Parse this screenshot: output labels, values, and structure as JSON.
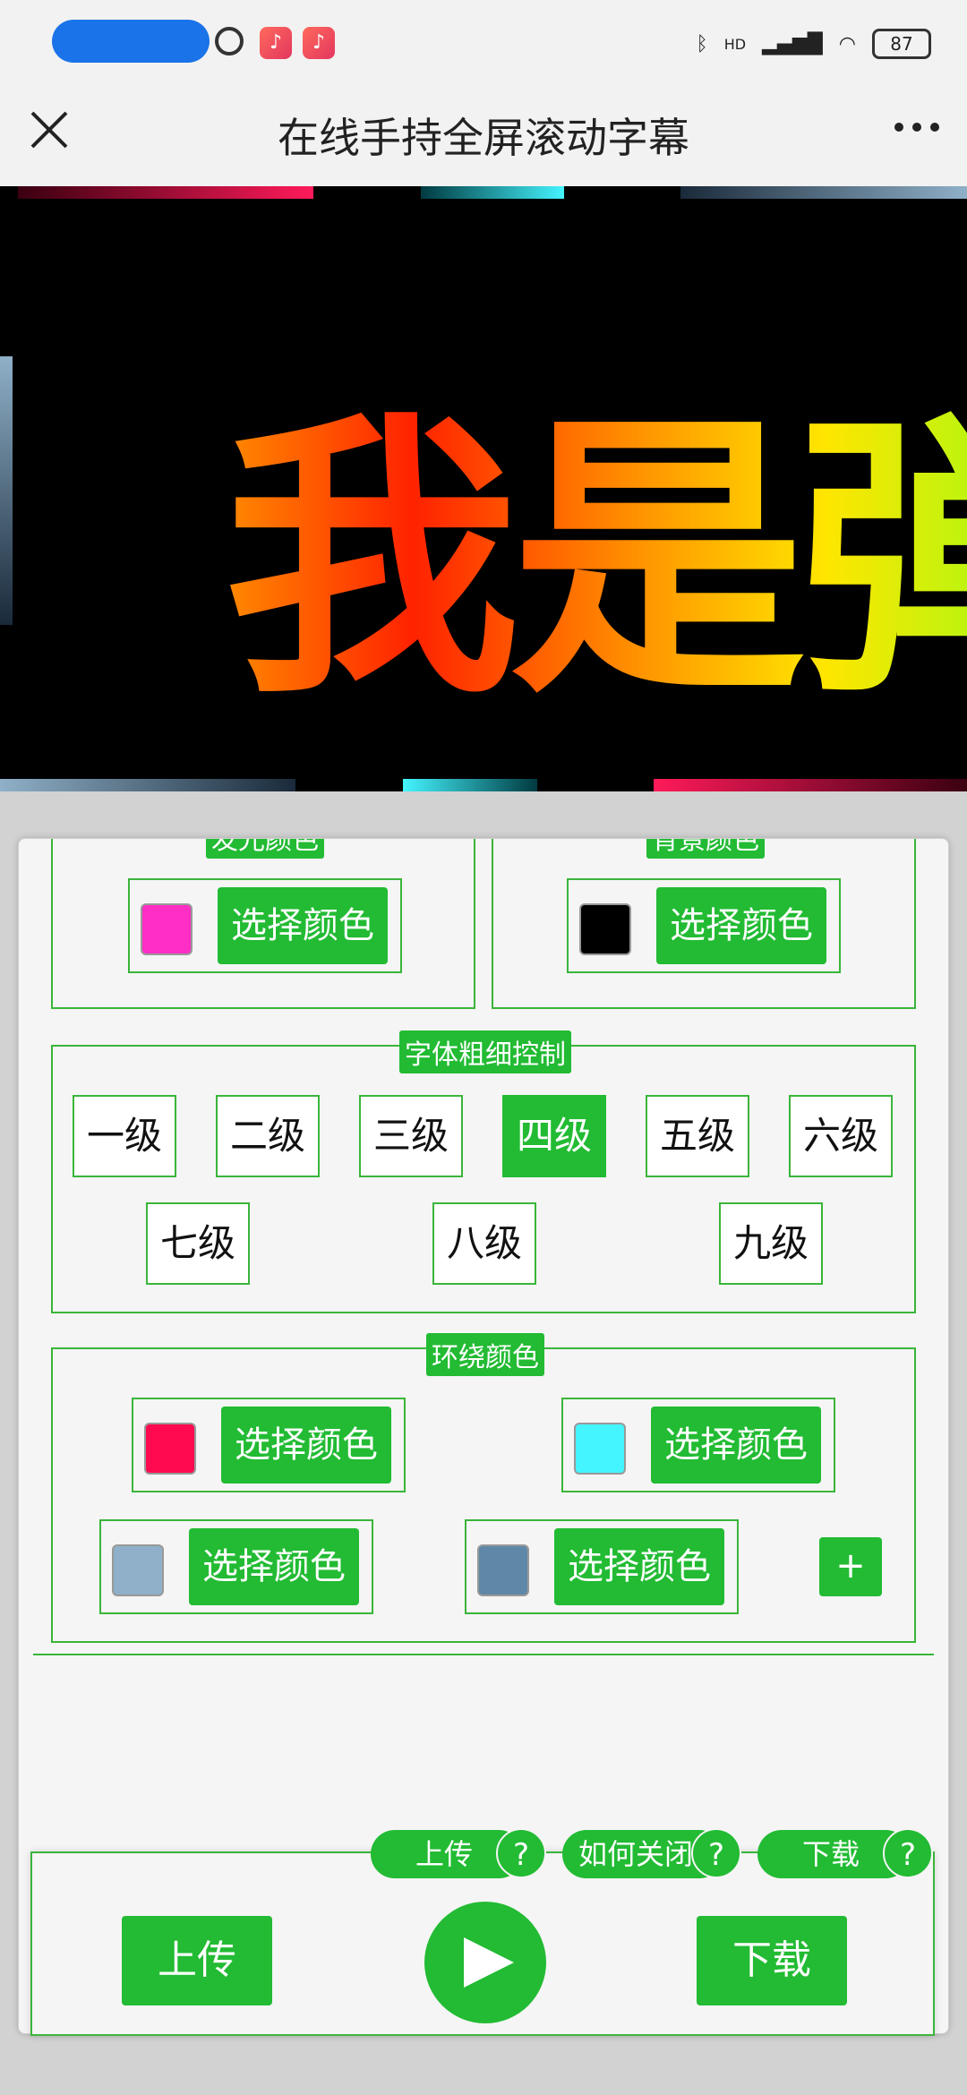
{
  "status_bar": {
    "battery": "87",
    "network_label": "HD"
  },
  "header": {
    "title": "在线手持全屏滚动字幕"
  },
  "preview": {
    "text": "我是弹"
  },
  "glow_color": {
    "legend": "发光颜色",
    "swatch_color": "#ff2ec4",
    "button": "选择颜色"
  },
  "background_color": {
    "legend": "背景颜色",
    "swatch_color": "#000000",
    "button": "选择颜色"
  },
  "font_weight": {
    "legend": "字体粗细控制",
    "levels": [
      "一级",
      "二级",
      "三级",
      "四级",
      "五级",
      "六级",
      "七级",
      "八级",
      "九级"
    ],
    "selected": "四级"
  },
  "surround_color": {
    "legend": "环绕颜色",
    "pickers": [
      {
        "swatch_color": "#ff0a50",
        "button": "选择颜色"
      },
      {
        "swatch_color": "#44f4ff",
        "button": "选择颜色"
      },
      {
        "swatch_color": "#8fb0c8",
        "button": "选择颜色"
      },
      {
        "swatch_color": "#5f88a8",
        "button": "选择颜色"
      }
    ],
    "add_label": "+"
  },
  "bottom_bar": {
    "help": [
      {
        "label": "上传",
        "q": "?"
      },
      {
        "label": "如何关闭",
        "q": "?"
      },
      {
        "label": "下载",
        "q": "?"
      }
    ],
    "upload": "上传",
    "download": "下载"
  },
  "colors": {
    "accent": "#22bb33",
    "border": "#3ab53a"
  }
}
